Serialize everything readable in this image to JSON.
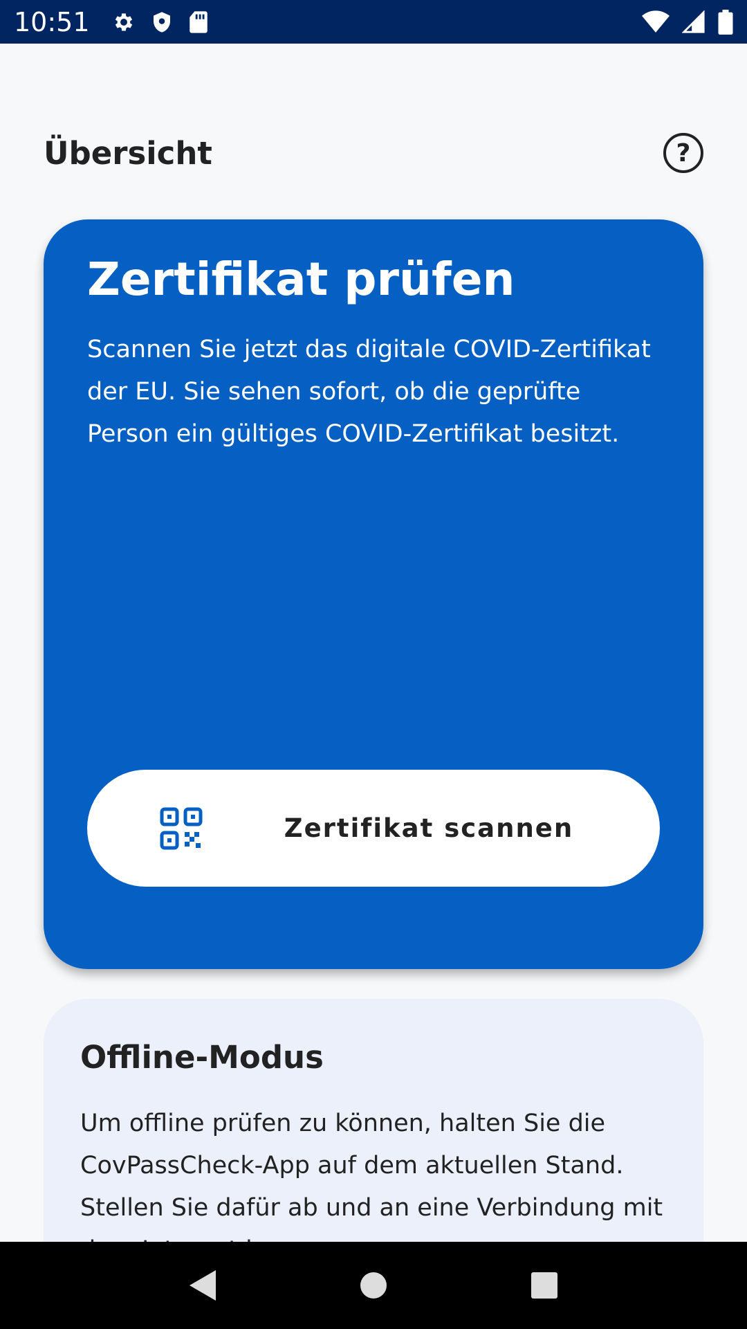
{
  "status_bar": {
    "time": "10:51",
    "icons_left": [
      "gear-icon",
      "shield-icon",
      "sd-card-icon"
    ],
    "icons_right": [
      "wifi-icon",
      "cell-signal-icon",
      "battery-icon"
    ]
  },
  "header": {
    "title": "Übersicht",
    "help_label": "?"
  },
  "check_card": {
    "title": "Zertifikat prüfen",
    "description": "Scannen Sie jetzt das digitale COVID-Zertifikat der EU. Sie sehen sofort, ob die geprüfte Person ein gültiges COVID-Zertifikat besitzt.",
    "scan_button_label": "Zertifikat scannen",
    "scan_icon": "qr-code-icon"
  },
  "offline_card": {
    "title": "Offline-Modus",
    "text": "Um offline prüfen zu können, halten Sie die CovPassCheck-App auf dem aktuellen Stand. Stellen Sie dafür ab und an eine Verbindung mit dem Internet her."
  },
  "nav_bar": {
    "buttons": [
      "back-icon",
      "home-icon",
      "recents-icon"
    ]
  },
  "colors": {
    "status_bar": "#002561",
    "card_blue": "#065fc3",
    "offline_card_bg": "#ebf0fb",
    "page_bg": "#f7f8fa",
    "text_dark": "#222222"
  }
}
